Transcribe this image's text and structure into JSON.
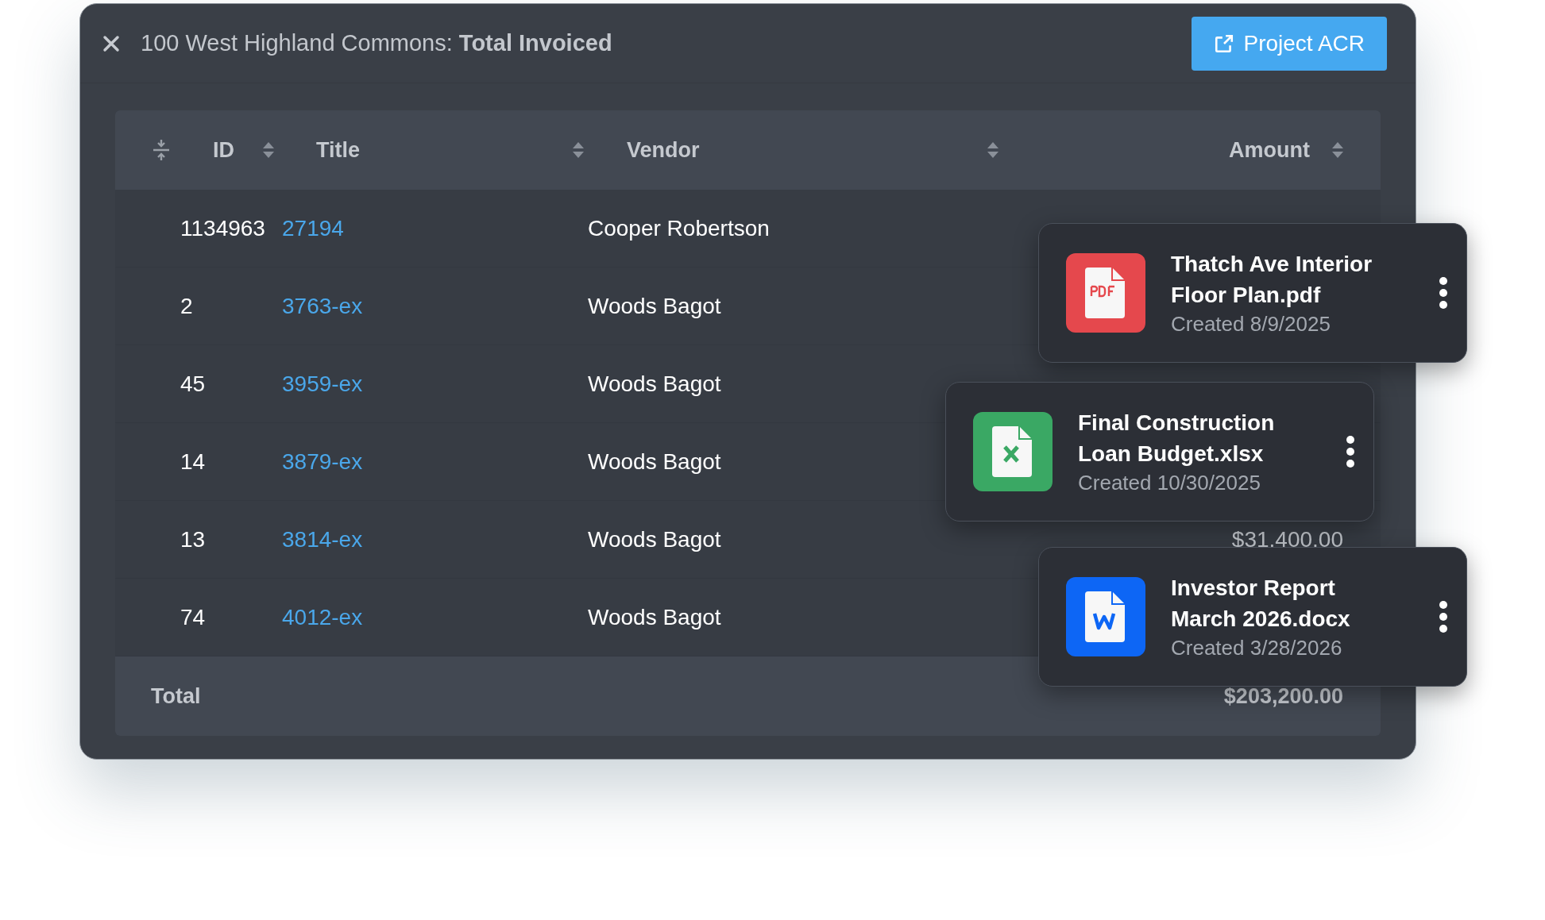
{
  "window": {
    "title": "100 West Highland Commons: **Total Invoiced**",
    "action_button": "Project ACR"
  },
  "table": {
    "columns": [
      {
        "label": "ID"
      },
      {
        "label": "Title"
      },
      {
        "label": "Vendor"
      },
      {
        "label": "Amount"
      }
    ],
    "rows": [
      {
        "id": "1134963",
        "title": "27194",
        "vendor": "Cooper Robertson"
      },
      {
        "id": "2",
        "title": "3763-ex",
        "vendor": "Woods Bagot"
      },
      {
        "id": "45",
        "title": "3959-ex",
        "vendor": "Woods Bagot"
      },
      {
        "id": "14",
        "title": "3879-ex",
        "vendor": "Woods Bagot"
      },
      {
        "id": "13",
        "title": "3814-ex",
        "vendor": "Woods Bagot",
        "amount": "$31,400.00"
      },
      {
        "id": "74",
        "title": "4012-ex",
        "vendor": "Woods Bagot"
      }
    ],
    "total": {
      "label": "Total",
      "amount": "$203,200.00"
    }
  },
  "files": [
    {
      "kind": "pdf",
      "name": "Thatch Ave Interior Floor Plan.pdf",
      "created": "Created 8/9/2025"
    },
    {
      "kind": "xlsx",
      "name": "Final Construction Loan Budget.xlsx",
      "created": "Created 10/30/2025"
    },
    {
      "kind": "docx",
      "name": "Investor Report March 2026.docx",
      "created": "Created 3/28/2026"
    }
  ]
}
